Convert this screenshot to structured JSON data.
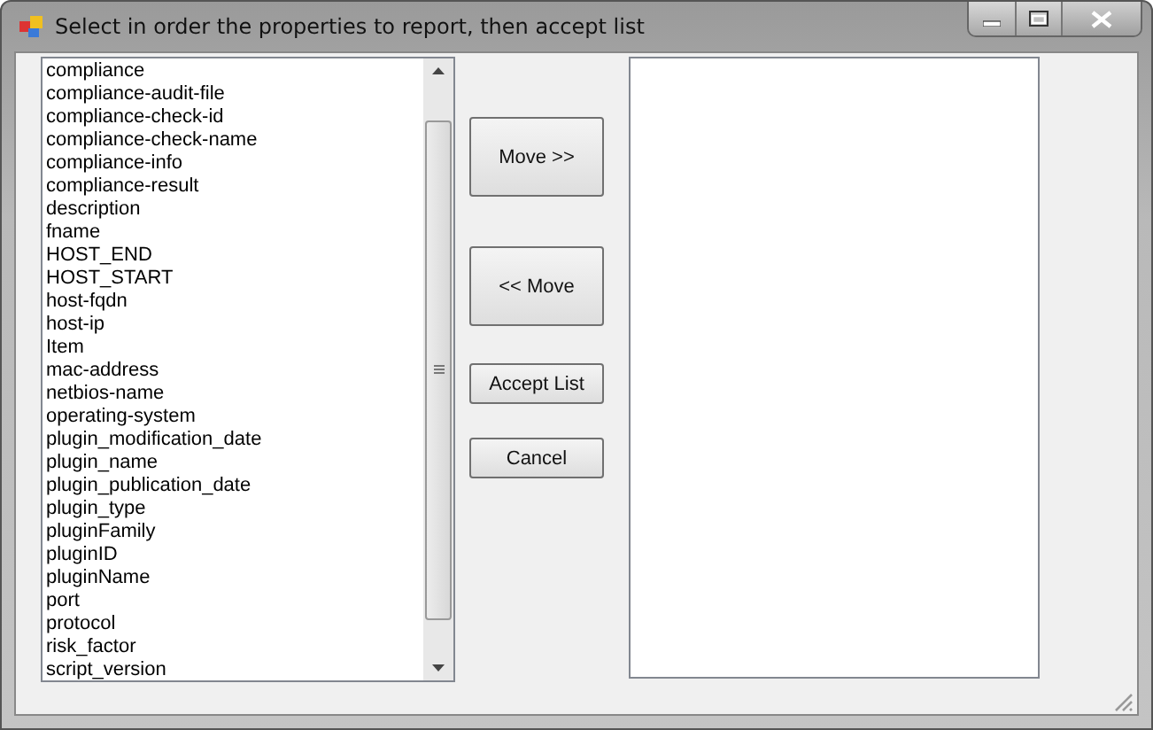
{
  "window": {
    "title": "Select in order the properties to report, then accept list"
  },
  "available_list": {
    "items": [
      "compliance",
      "compliance-audit-file",
      "compliance-check-id",
      "compliance-check-name",
      "compliance-info",
      "compliance-result",
      "description",
      "fname",
      "HOST_END",
      "HOST_START",
      "host-fqdn",
      "host-ip",
      "Item",
      "mac-address",
      "netbios-name",
      "operating-system",
      "plugin_modification_date",
      "plugin_name",
      "plugin_publication_date",
      "plugin_type",
      "pluginFamily",
      "pluginID",
      "pluginName",
      "port",
      "protocol",
      "risk_factor",
      "script_version"
    ]
  },
  "buttons": [
    {
      "label": "Move >>",
      "kind": "tall"
    },
    {
      "label": "<< Move",
      "kind": "tall"
    },
    {
      "label": "Accept List",
      "kind": "short"
    },
    {
      "label": "Cancel",
      "kind": "short"
    }
  ]
}
